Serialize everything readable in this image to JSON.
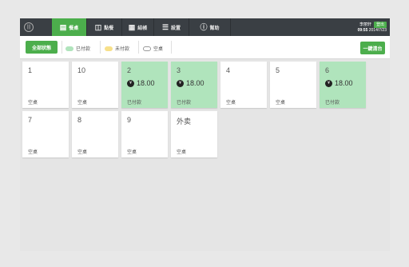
{
  "nav": {
    "tabs": [
      {
        "label": "餐桌",
        "icon": "table-icon"
      },
      {
        "label": "點餐",
        "icon": "book-icon"
      },
      {
        "label": "結帳",
        "icon": "calculator-icon"
      },
      {
        "label": "設置",
        "icon": "list-icon"
      },
      {
        "label": "幫助",
        "icon": "help-icon"
      }
    ],
    "user": "李丽轩",
    "logout_label": "登出",
    "time": "09:55",
    "date": "2014/7/23"
  },
  "toolbar": {
    "all_status_label": "全部狀態",
    "clear_all_label": "一鍵清台",
    "legend": [
      {
        "label": "已付款",
        "color": "#b0e4bc"
      },
      {
        "label": "未付款",
        "color": "#f7e08a"
      },
      {
        "label": "空桌",
        "color": "#ffffff"
      }
    ]
  },
  "colors": {
    "accent": "#4cae4c",
    "paid": "#b0e4bc",
    "topbar": "#3a3f44"
  },
  "tables": [
    {
      "name": "1",
      "status": "空桌",
      "amount": null,
      "state": "empty"
    },
    {
      "name": "10",
      "status": "空桌",
      "amount": null,
      "state": "empty"
    },
    {
      "name": "2",
      "status": "已付款",
      "amount": "18.00",
      "state": "paid"
    },
    {
      "name": "3",
      "status": "已付款",
      "amount": "18.00",
      "state": "paid"
    },
    {
      "name": "4",
      "status": "空桌",
      "amount": null,
      "state": "empty"
    },
    {
      "name": "5",
      "status": "空桌",
      "amount": null,
      "state": "empty"
    },
    {
      "name": "6",
      "status": "已付款",
      "amount": "18.00",
      "state": "paid"
    },
    {
      "name": "7",
      "status": "空桌",
      "amount": null,
      "state": "empty"
    },
    {
      "name": "8",
      "status": "空桌",
      "amount": null,
      "state": "empty"
    },
    {
      "name": "9",
      "status": "空桌",
      "amount": null,
      "state": "empty"
    },
    {
      "name": "外卖",
      "status": "空桌",
      "amount": null,
      "state": "empty"
    }
  ],
  "currency_symbol": "¥"
}
